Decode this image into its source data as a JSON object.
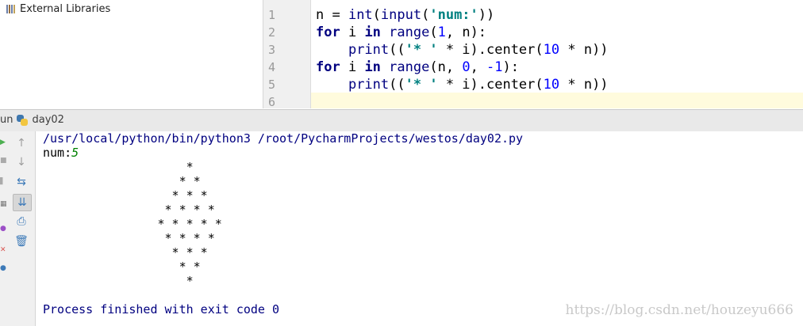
{
  "project": {
    "external_libraries": "External Libraries",
    "icon": "library-icon"
  },
  "editor": {
    "line_numbers": [
      "1",
      "2",
      "3",
      "4",
      "5",
      "6"
    ],
    "lines": [
      [
        {
          "t": "n = ",
          "c": ""
        },
        {
          "t": "int",
          "c": "fn"
        },
        {
          "t": "(",
          "c": ""
        },
        {
          "t": "input",
          "c": "fn"
        },
        {
          "t": "(",
          "c": ""
        },
        {
          "t": "'num:'",
          "c": "str"
        },
        {
          "t": "))",
          "c": ""
        }
      ],
      [
        {
          "t": "for",
          "c": "kw"
        },
        {
          "t": " i ",
          "c": ""
        },
        {
          "t": "in",
          "c": "kw"
        },
        {
          "t": " ",
          "c": ""
        },
        {
          "t": "range",
          "c": "fn"
        },
        {
          "t": "(",
          "c": ""
        },
        {
          "t": "1",
          "c": "num"
        },
        {
          "t": ", n):",
          "c": ""
        }
      ],
      [
        {
          "t": "    ",
          "c": ""
        },
        {
          "t": "print",
          "c": "fn"
        },
        {
          "t": "((",
          "c": ""
        },
        {
          "t": "'* '",
          "c": "str"
        },
        {
          "t": " * i).center(",
          "c": ""
        },
        {
          "t": "10",
          "c": "num"
        },
        {
          "t": " * n))",
          "c": ""
        }
      ],
      [
        {
          "t": "for",
          "c": "kw"
        },
        {
          "t": " i ",
          "c": ""
        },
        {
          "t": "in",
          "c": "kw"
        },
        {
          "t": " ",
          "c": ""
        },
        {
          "t": "range",
          "c": "fn"
        },
        {
          "t": "(n, ",
          "c": ""
        },
        {
          "t": "0",
          "c": "num"
        },
        {
          "t": ", ",
          "c": ""
        },
        {
          "t": "-1",
          "c": "num"
        },
        {
          "t": "):",
          "c": ""
        }
      ],
      [
        {
          "t": "    ",
          "c": ""
        },
        {
          "t": "print",
          "c": "fn"
        },
        {
          "t": "((",
          "c": ""
        },
        {
          "t": "'* '",
          "c": "str"
        },
        {
          "t": " * i).center(",
          "c": ""
        },
        {
          "t": "10",
          "c": "num"
        },
        {
          "t": " * n))",
          "c": ""
        }
      ],
      []
    ]
  },
  "run": {
    "tab_prefix": "un",
    "config_name": "day02",
    "command": "/usr/local/python/bin/python3 /root/PycharmProjects/westos/day02.py",
    "prompt": "num:",
    "input_value": "5",
    "output_lines": [
      "                    *",
      "                   * *",
      "                  * * *",
      "                 * * * *",
      "                * * * * *",
      "                 * * * *",
      "                  * * *",
      "                   * *",
      "                    *"
    ],
    "exit_message": "Process finished with exit code 0",
    "watermark": "https://blog.csdn.net/houzeyu666"
  },
  "toolbar": {
    "icons": [
      "up-arrow-icon",
      "down-arrow-icon",
      "soft-wrap-icon",
      "scroll-to-end-icon",
      "print-icon",
      "trash-icon"
    ]
  },
  "colors": {
    "keyword": "#000080",
    "string": "#008080",
    "number": "#0000ff",
    "console_user_input": "#008000"
  }
}
